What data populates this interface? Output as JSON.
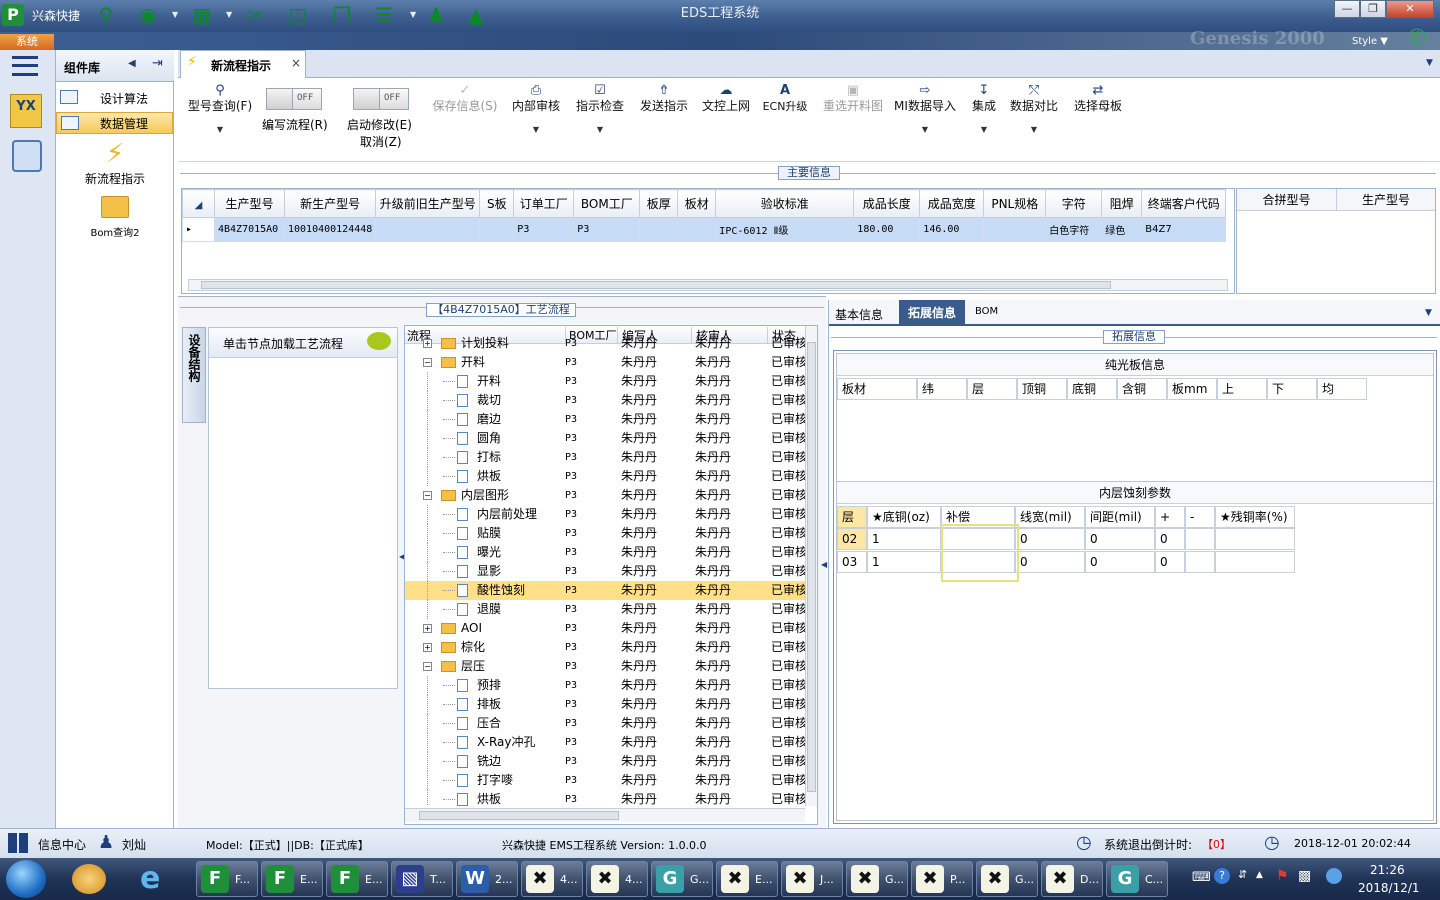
{
  "app": {
    "title": "EDS工程系统",
    "shortcut_label": "兴森快捷",
    "logo_letter": "P",
    "style_label": "Style",
    "system_tab": "系统",
    "brand_watermark": "Genesis 2000"
  },
  "colors": {
    "accent": "#3a5b8b",
    "selection": "#ffe089",
    "grid_select": "#c6dcf6",
    "focus_border": "#e4e27a"
  },
  "nav": {
    "pane_title": "组件库",
    "groups": [
      {
        "label": "设计算法"
      },
      {
        "label": "数据管理"
      }
    ],
    "items": [
      {
        "label": "新流程指示",
        "icon": "lightning-icon"
      },
      {
        "label": "Bom查询2",
        "icon": "folder-open-icon"
      }
    ]
  },
  "tab": {
    "label": "新流程指示",
    "close": "×"
  },
  "toolbar": {
    "model_query": "型号查询(F)",
    "toggle_off": "OFF",
    "edit_flow": "编写流程(R)",
    "start_modify": "启动修改(E)",
    "cancel": "取消(Z)",
    "buttons": [
      {
        "label": "保存信息(S)",
        "icon": "check-icon",
        "enabled": false
      },
      {
        "label": "内部审核",
        "icon": "printer-icon",
        "enabled": true
      },
      {
        "label": "指示检查",
        "icon": "checkbox-icon",
        "enabled": true
      },
      {
        "label": "发送指示",
        "icon": "upload-icon",
        "enabled": true
      },
      {
        "label": "文控上网",
        "icon": "cloud-upload-icon",
        "enabled": true
      },
      {
        "label": "ECN升级",
        "icon": "ecn-icon",
        "enabled": true
      },
      {
        "label": "重选开料图",
        "icon": "image-icon",
        "enabled": false
      },
      {
        "label": "MI数据导入",
        "icon": "import-icon",
        "enabled": true
      },
      {
        "label": "集成",
        "icon": "download-icon",
        "enabled": true
      },
      {
        "label": "数据对比",
        "icon": "compare-icon",
        "enabled": true
      },
      {
        "label": "选择母板",
        "icon": "shuffle-icon",
        "enabled": true
      }
    ]
  },
  "main_info": {
    "title": "主要信息",
    "columns": [
      "生产型号",
      "新生产型号",
      "升级前旧生产型号",
      "S板",
      "订单工厂",
      "BOM工厂",
      "板厚",
      "板材",
      "验收标准",
      "成品长度",
      "成品宽度",
      "PNL规格",
      "字符",
      "阻焊",
      "终端客户代码"
    ],
    "row": [
      "4B4Z7015A0",
      "10010400124448",
      "",
      "",
      "P3",
      "P3",
      "",
      "",
      "IPC-6012 Ⅱ级",
      "180.00",
      "146.00",
      "",
      "白色字符",
      "绿色",
      "B4Z7"
    ],
    "side_columns": [
      "合拼型号",
      "生产型号"
    ]
  },
  "process": {
    "title": "【4B4Z7015A0】工艺流程",
    "side_tab": "设备结构",
    "hint": "单击节点加载工艺流程",
    "columns": [
      "流程",
      "BOM工厂",
      "编写人",
      "核审人",
      "状态"
    ],
    "rows": [
      {
        "name": "计划投料",
        "level": 0,
        "type": "folder",
        "exp": "+",
        "bom": "P3",
        "writer": "朱丹丹",
        "reviewer": "朱丹丹",
        "status": "已审核"
      },
      {
        "name": "开料",
        "level": 0,
        "type": "folder",
        "exp": "-",
        "bom": "P3",
        "writer": "朱丹丹",
        "reviewer": "朱丹丹",
        "status": "已审核"
      },
      {
        "name": "开料",
        "level": 1,
        "type": "doc",
        "bom": "P3",
        "writer": "朱丹丹",
        "reviewer": "朱丹丹",
        "status": "已审核"
      },
      {
        "name": "裁切",
        "level": 1,
        "type": "doc",
        "bom": "P3",
        "writer": "朱丹丹",
        "reviewer": "朱丹丹",
        "status": "已审核"
      },
      {
        "name": "磨边",
        "level": 1,
        "type": "doc",
        "bom": "P3",
        "writer": "朱丹丹",
        "reviewer": "朱丹丹",
        "status": "已审核"
      },
      {
        "name": "圆角",
        "level": 1,
        "type": "doc",
        "bom": "P3",
        "writer": "朱丹丹",
        "reviewer": "朱丹丹",
        "status": "已审核"
      },
      {
        "name": "打标",
        "level": 1,
        "type": "doc",
        "bom": "P3",
        "writer": "朱丹丹",
        "reviewer": "朱丹丹",
        "status": "已审核"
      },
      {
        "name": "烘板",
        "level": 1,
        "type": "doc",
        "bom": "P3",
        "writer": "朱丹丹",
        "reviewer": "朱丹丹",
        "status": "已审核"
      },
      {
        "name": "内层图形",
        "level": 0,
        "type": "folder",
        "exp": "-",
        "bom": "P3",
        "writer": "朱丹丹",
        "reviewer": "朱丹丹",
        "status": "已审核"
      },
      {
        "name": "内层前处理",
        "level": 1,
        "type": "doc",
        "bom": "P3",
        "writer": "朱丹丹",
        "reviewer": "朱丹丹",
        "status": "已审核"
      },
      {
        "name": "贴膜",
        "level": 1,
        "type": "doc",
        "bom": "P3",
        "writer": "朱丹丹",
        "reviewer": "朱丹丹",
        "status": "已审核"
      },
      {
        "name": "曝光",
        "level": 1,
        "type": "doc",
        "bom": "P3",
        "writer": "朱丹丹",
        "reviewer": "朱丹丹",
        "status": "已审核"
      },
      {
        "name": "显影",
        "level": 1,
        "type": "doc",
        "bom": "P3",
        "writer": "朱丹丹",
        "reviewer": "朱丹丹",
        "status": "已审核"
      },
      {
        "name": "酸性蚀刻",
        "level": 1,
        "type": "doc",
        "bom": "P3",
        "writer": "朱丹丹",
        "reviewer": "朱丹丹",
        "status": "已审核",
        "selected": true
      },
      {
        "name": "退膜",
        "level": 1,
        "type": "doc",
        "bom": "P3",
        "writer": "朱丹丹",
        "reviewer": "朱丹丹",
        "status": "已审核"
      },
      {
        "name": "AOI",
        "level": 0,
        "type": "folder",
        "exp": "+",
        "bom": "P3",
        "writer": "朱丹丹",
        "reviewer": "朱丹丹",
        "status": "已审核"
      },
      {
        "name": "棕化",
        "level": 0,
        "type": "folder",
        "exp": "+",
        "bom": "P3",
        "writer": "朱丹丹",
        "reviewer": "朱丹丹",
        "status": "已审核"
      },
      {
        "name": "层压",
        "level": 0,
        "type": "folder",
        "exp": "-",
        "bom": "P3",
        "writer": "朱丹丹",
        "reviewer": "朱丹丹",
        "status": "已审核"
      },
      {
        "name": "预排",
        "level": 1,
        "type": "doc",
        "bom": "P3",
        "writer": "朱丹丹",
        "reviewer": "朱丹丹",
        "status": "已审核"
      },
      {
        "name": "排板",
        "level": 1,
        "type": "doc",
        "bom": "P3",
        "writer": "朱丹丹",
        "reviewer": "朱丹丹",
        "status": "已审核"
      },
      {
        "name": "压合",
        "level": 1,
        "type": "doc",
        "bom": "P3",
        "writer": "朱丹丹",
        "reviewer": "朱丹丹",
        "status": "已审核"
      },
      {
        "name": "X-Ray冲孔",
        "level": 1,
        "type": "doc",
        "bom": "P3",
        "writer": "朱丹丹",
        "reviewer": "朱丹丹",
        "status": "已审核"
      },
      {
        "name": "铣边",
        "level": 1,
        "type": "doc",
        "bom": "P3",
        "writer": "朱丹丹",
        "reviewer": "朱丹丹",
        "status": "已审核"
      },
      {
        "name": "打字嘜",
        "level": 1,
        "type": "doc",
        "bom": "P3",
        "writer": "朱丹丹",
        "reviewer": "朱丹丹",
        "status": "已审核"
      },
      {
        "name": "烘板",
        "level": 1,
        "type": "doc",
        "bom": "P3",
        "writer": "朱丹丹",
        "reviewer": "朱丹丹",
        "status": "已审核"
      }
    ]
  },
  "detail": {
    "tabs": [
      "基本信息",
      "拓展信息",
      "BOM"
    ],
    "section_title": "拓展信息",
    "plain_board": {
      "title": "纯光板信息",
      "columns": [
        "板材",
        "纬",
        "层",
        "顶铜",
        "底铜",
        "含铜",
        "板mm",
        "上",
        "下",
        "均"
      ]
    },
    "etch": {
      "title": "内层蚀刻参数",
      "columns": [
        "层",
        "★底铜(oz)",
        "补偿",
        "线宽(mil)",
        "间距(mil)",
        "+",
        "-",
        "★残铜率(%)"
      ],
      "rows": [
        [
          "02",
          "1",
          "",
          "0",
          "0",
          "0",
          "",
          ""
        ],
        [
          "03",
          "1",
          "",
          "0",
          "0",
          "0",
          "",
          ""
        ]
      ]
    }
  },
  "status": {
    "info_center": "信息中心",
    "user": "刘灿",
    "model": "Model:【正式】||DB:【正式库】",
    "version": "兴森快捷 EMS工程系统 Version: 1.0.0.0",
    "exit_countdown": "系统退出倒计时:",
    "countdown_value": "【0】",
    "datetime": "2018-12-01 20:02:44"
  },
  "taskbar": {
    "time": "21:26",
    "date": "2018/12/1",
    "buttons": [
      {
        "label": "F...",
        "icon": "F"
      },
      {
        "label": "E...",
        "icon": "F"
      },
      {
        "label": "E...",
        "icon": "F"
      },
      {
        "label": "T...",
        "icon": "floppy"
      },
      {
        "label": "2...",
        "icon": "W"
      },
      {
        "label": "4...",
        "icon": "X"
      },
      {
        "label": "4...",
        "icon": "X"
      },
      {
        "label": "G...",
        "icon": "G"
      },
      {
        "label": "E...",
        "icon": "X"
      },
      {
        "label": "J...",
        "icon": "X"
      },
      {
        "label": "G...",
        "icon": "X"
      },
      {
        "label": "P...",
        "icon": "X"
      },
      {
        "label": "G...",
        "icon": "X"
      },
      {
        "label": "D...",
        "icon": "X"
      },
      {
        "label": "C...",
        "icon": "G"
      }
    ]
  }
}
